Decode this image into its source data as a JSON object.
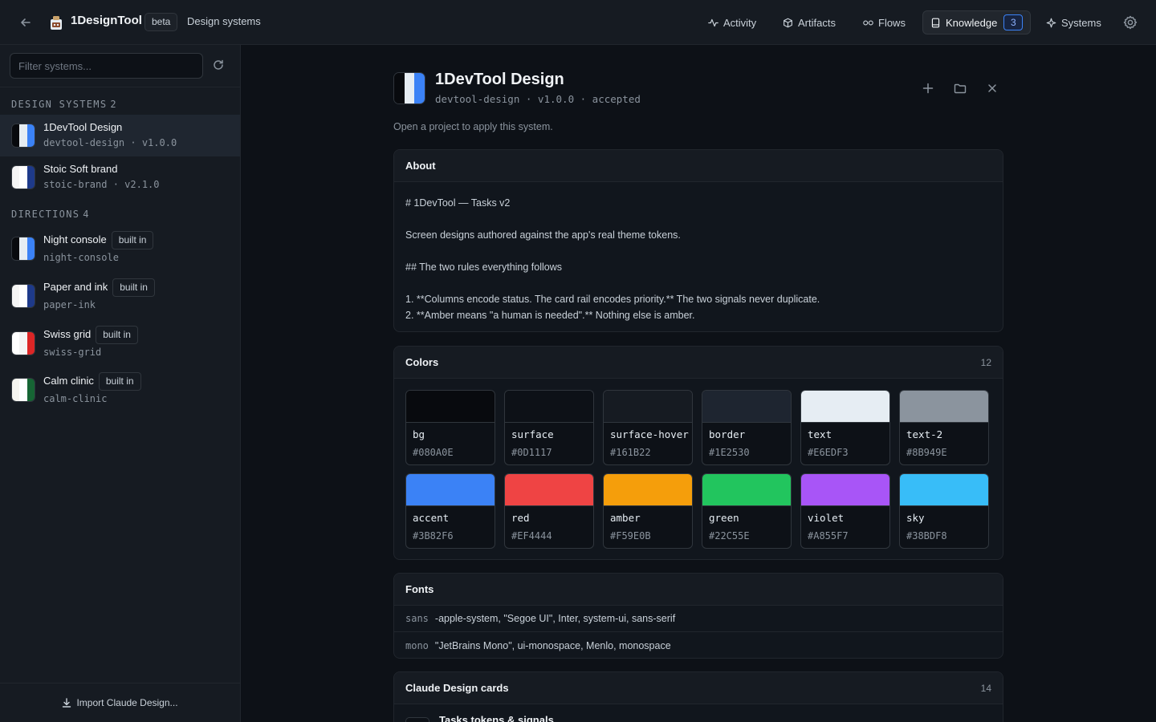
{
  "topbar": {
    "app_name": "1DesignTool",
    "beta": "beta",
    "breadcrumb": "Design systems",
    "nav": [
      {
        "label": "Activity",
        "icon": "activity-icon"
      },
      {
        "label": "Artifacts",
        "icon": "cube-icon"
      },
      {
        "label": "Flows",
        "icon": "flow-icon"
      },
      {
        "label": "Knowledge",
        "icon": "book-icon",
        "count": "3",
        "active": true
      },
      {
        "label": "Systems",
        "icon": "sparkle-icon"
      }
    ]
  },
  "sidebar": {
    "filter_placeholder": "Filter systems...",
    "design_systems_heading": "DESIGN SYSTEMS",
    "design_systems_count": "2",
    "design_systems": [
      {
        "name": "1DevTool Design",
        "sub": "devtool-design · v1.0.0",
        "colors": [
          "#080A0E",
          "#E6EDF3",
          "#3B82F6"
        ]
      },
      {
        "name": "Stoic Soft brand",
        "sub": "stoic-brand · v2.1.0",
        "colors": [
          "#F5F5F5",
          "#FFFFFF",
          "#1E3A8A"
        ]
      }
    ],
    "directions_heading": "DIRECTIONS",
    "directions_count": "4",
    "directions": [
      {
        "name": "Night console",
        "badge": "built in",
        "sub": "night-console",
        "colors": [
          "#080A0E",
          "#E6EDF3",
          "#3B82F6"
        ]
      },
      {
        "name": "Paper and ink",
        "badge": "built in",
        "sub": "paper-ink",
        "colors": [
          "#F5F5F5",
          "#FFFFFF",
          "#1E3A8A"
        ]
      },
      {
        "name": "Swiss grid",
        "badge": "built in",
        "sub": "swiss-grid",
        "colors": [
          "#FFFFFF",
          "#F5F5F5",
          "#DC2626"
        ]
      },
      {
        "name": "Calm clinic",
        "badge": "built in",
        "sub": "calm-clinic",
        "colors": [
          "#F5F5F0",
          "#FFFFFF",
          "#166534"
        ]
      }
    ],
    "footer": "Import Claude Design..."
  },
  "main": {
    "title": "1DevTool Design",
    "meta": "devtool-design · v1.0.0 · accepted",
    "header_colors": [
      "#080A0E",
      "#E6EDF3",
      "#3B82F6"
    ],
    "note": "Open a project to apply this system.",
    "about": {
      "title": "About",
      "lines": [
        "# 1DevTool — Tasks v2",
        "Screen designs authored against the app's real theme tokens.",
        "## The two rules everything follows",
        "1. **Columns encode status. The card rail encodes priority.** The two signals never duplicate.",
        "2. **Amber means \"a human is needed\".** Nothing else is amber."
      ]
    },
    "colors": {
      "title": "Colors",
      "count": "12",
      "items": [
        {
          "name": "bg",
          "hex": "#080A0E"
        },
        {
          "name": "surface",
          "hex": "#0D1117"
        },
        {
          "name": "surface-hover",
          "hex": "#161B22"
        },
        {
          "name": "border",
          "hex": "#1E2530"
        },
        {
          "name": "text",
          "hex": "#E6EDF3"
        },
        {
          "name": "text-2",
          "hex": "#8B949E"
        },
        {
          "name": "accent",
          "hex": "#3B82F6"
        },
        {
          "name": "red",
          "hex": "#EF4444"
        },
        {
          "name": "amber",
          "hex": "#F59E0B"
        },
        {
          "name": "green",
          "hex": "#22C55E"
        },
        {
          "name": "violet",
          "hex": "#A855F7"
        },
        {
          "name": "sky",
          "hex": "#38BDF8"
        }
      ]
    },
    "fonts": {
      "title": "Fonts",
      "items": [
        {
          "key": "sans",
          "value": "-apple-system, \"Segoe UI\", Inter, system-ui, sans-serif"
        },
        {
          "key": "mono",
          "value": "\"JetBrains Mono\", ui-monospace, Menlo, monospace"
        }
      ]
    },
    "cards": {
      "title": "Claude Design cards",
      "count": "14",
      "first_item": "Tasks tokens & signals"
    }
  }
}
